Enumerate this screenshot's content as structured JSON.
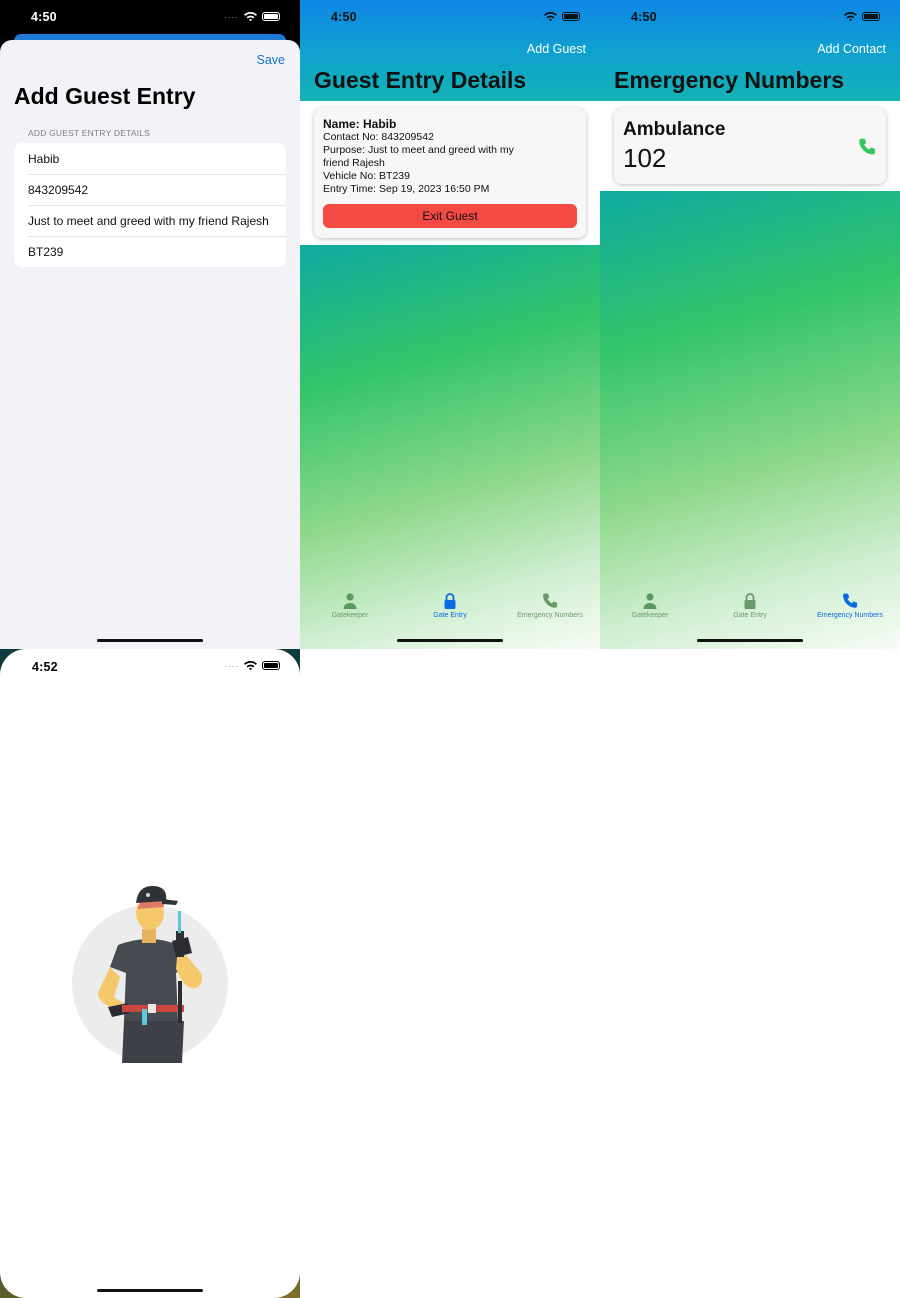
{
  "screens": {
    "add_guest": {
      "status_time": "4:50",
      "save_label": "Save",
      "title": "Add Guest Entry",
      "section_header": "ADD GUEST ENTRY DETAILS",
      "fields": [
        "Habib",
        "843209542",
        "Just to meet and greed with my friend Rajesh",
        "BT239"
      ]
    },
    "guest_details": {
      "status_time": "4:50",
      "action_label": "Add Guest",
      "title": "Guest Entry Details",
      "card": {
        "name": "Name: Habib",
        "contact": "Contact No: 843209542",
        "purpose": "Purpose: Just to meet and greed with my friend Rajesh",
        "vehicle": "Vehicle No: BT239",
        "entry_time": "Entry Time: Sep 19, 2023 16:50 PM",
        "exit_label": "Exit Guest"
      }
    },
    "emergency": {
      "status_time": "4:50",
      "action_label": "Add Contact",
      "title": "Emergency Numbers",
      "contact": {
        "name": "Ambulance",
        "number": "102"
      }
    },
    "splash": {
      "status_time": "4:52"
    }
  },
  "tabs": [
    {
      "label": "Gatekeeper",
      "icon": "person-icon"
    },
    {
      "label": "Gate Entry",
      "icon": "lock-icon"
    },
    {
      "label": "Emergency Numbers",
      "icon": "phone-icon"
    }
  ],
  "colors": {
    "accent": "#0a6be0",
    "exit_button": "#f44a44",
    "call_icon": "#34c759",
    "tab_inactive": "#6a9a6a"
  }
}
